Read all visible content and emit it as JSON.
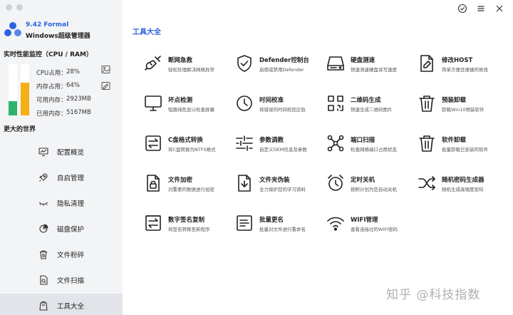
{
  "app": {
    "version": "9.42 Formal",
    "name": "Windows超级管理器"
  },
  "perf": {
    "title": "实时性能监控（CPU / RAM）",
    "cpu_label": "CPU占用：",
    "cpu_value": "28%",
    "cpu_fraction": 0.28,
    "mem_label": "内存占用：",
    "mem_value": "64%",
    "mem_fraction": 0.64,
    "avail_label": "可用内存：",
    "avail_value": "2923MB",
    "used_label": "已用内存：",
    "used_value": "5167MB"
  },
  "sidebar": {
    "section_title": "更大的世界",
    "items": [
      {
        "label": "配置概览",
        "icon": "monitor-chart-icon"
      },
      {
        "label": "自启管理",
        "icon": "rocket-icon"
      },
      {
        "label": "隐私清理",
        "icon": "eye-closed-icon"
      },
      {
        "label": "磁盘保护",
        "icon": "pie-chart-icon"
      },
      {
        "label": "文件粉碎",
        "icon": "trash-icon"
      },
      {
        "label": "文件扫描",
        "icon": "file-search-icon"
      },
      {
        "label": "工具大全",
        "icon": "toolbox-icon"
      }
    ],
    "active_index": 6
  },
  "main": {
    "section_title": "工具大全",
    "tools": [
      {
        "name": "断网急救",
        "desc": "轻松处理解决网络异常",
        "icon": "plug-icon"
      },
      {
        "name": "Defender控制台",
        "desc": "启用或禁用Defender",
        "icon": "shield-check-icon"
      },
      {
        "name": "硬盘测速",
        "desc": "快速测速硬盘读写速度",
        "icon": "hard-drive-icon"
      },
      {
        "name": "修改HOST",
        "desc": "简单方便且便捷的修改",
        "icon": "document-edit-icon"
      },
      {
        "name": "坏点检测",
        "desc": "短路纯色显以检查屏幕",
        "icon": "monitor-icon"
      },
      {
        "name": "时间校准",
        "desc": "将错误的时间校回正轨",
        "icon": "clock-icon"
      },
      {
        "name": "二维码生成",
        "desc": "快速生成二维码图片",
        "icon": "qr-code-icon"
      },
      {
        "name": "预装卸载",
        "desc": "卸载Win10预装软件",
        "icon": "trash-icon"
      },
      {
        "name": "C盘格式转换",
        "desc": "将C盘转换为NTFS格式",
        "icon": "transfer-icon"
      },
      {
        "name": "参数调教",
        "desc": "自定义OEM信息及参数",
        "icon": "sliders-icon"
      },
      {
        "name": "端口扫描",
        "desc": "检查网络端口占用状态",
        "icon": "network-scan-icon"
      },
      {
        "name": "软件卸载",
        "desc": "批量卸载已安装的软件",
        "icon": "trash-icon"
      },
      {
        "name": "文件加密",
        "desc": "对重要的数据进行加密",
        "icon": "file-lock-icon"
      },
      {
        "name": "文件夹伪装",
        "desc": "全力保护您的学习资料",
        "icon": "file-disguise-icon"
      },
      {
        "name": "定时关机",
        "desc": "按照计划为您自动关机",
        "icon": "alarm-clock-icon"
      },
      {
        "name": "随机密码生成器",
        "desc": "随机生成高强度密码",
        "icon": "shuffle-icon"
      },
      {
        "name": "数字签名复制",
        "desc": "将签名转移至新程序",
        "icon": "signature-copy-icon"
      },
      {
        "name": "批量更名",
        "desc": "批量对文件进行重命名",
        "icon": "batch-rename-icon"
      },
      {
        "name": "WIFI管理",
        "desc": "查看连接过的WIFI密码",
        "icon": "wifi-icon"
      }
    ]
  },
  "watermark": "知乎 @科技指数",
  "colors": {
    "accent": "#2b63e0",
    "cpu_bar": "#2fb36c",
    "mem_bar": "#f5b016",
    "sidebar_bg": "#f3f4f6",
    "active_bg": "#e2e4e9"
  }
}
